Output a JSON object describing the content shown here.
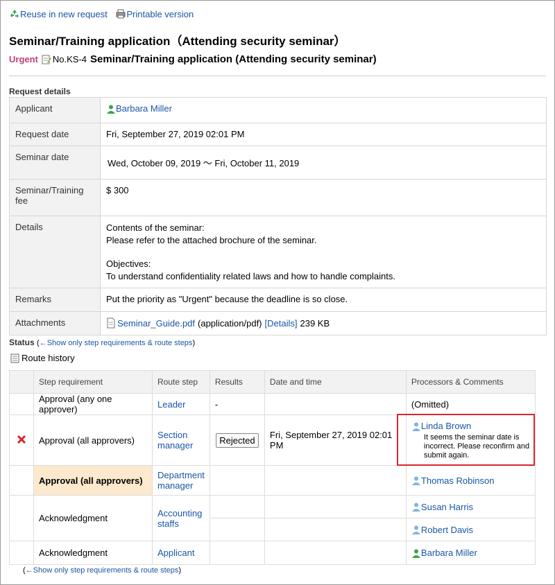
{
  "toolbar": {
    "reuse_label": "Reuse in new request",
    "print_label": "Printable version"
  },
  "page_title": "Seminar/Training application（Attending security seminar）",
  "subtitle": {
    "priority": "Urgent",
    "doc_no": "No.KS-4",
    "title": "Seminar/Training application (Attending security seminar)"
  },
  "details": {
    "section_label": "Request details",
    "applicant_label": "Applicant",
    "applicant": "Barbara Miller",
    "request_date_label": "Request date",
    "request_date": "Fri, September 27, 2019 02:01 PM",
    "seminar_date_label": "Seminar date",
    "seminar_date": "Wed, October 09, 2019 〜 Fri, October 11, 2019",
    "fee_label": "Seminar/Training fee",
    "fee": "$ 300",
    "details_label": "Details",
    "details_line1": "Contents of the seminar:",
    "details_line2": "Please refer to the attached brochure of the seminar.",
    "details_line3": "Objectives:",
    "details_line4": "To understand confidentiality related laws and how to handle complaints.",
    "remarks_label": "Remarks",
    "remarks": "Put the priority as \"Urgent\" because the deadline is so close.",
    "attachments_label": "Attachments",
    "attachment_name": "Seminar_Guide.pdf",
    "attachment_type": "(application/pdf)",
    "attachment_details": "[Details]",
    "attachment_size": "239 KB"
  },
  "status": {
    "label": "Status",
    "toggle_link": "←Show only step requirements & route steps",
    "route_history": "Route history"
  },
  "route": {
    "headers": [
      "Step requirement",
      "Route step",
      "Results",
      "Date and time",
      "Processors & Comments"
    ],
    "rows": [
      {
        "requirement": "Approval (any one approver)",
        "step": "Leader",
        "result": "-",
        "date": "",
        "processor": "(Omitted)"
      },
      {
        "requirement": "Approval (all approvers)",
        "step": "Section manager",
        "result": "Rejected",
        "date": "Fri, September 27, 2019 02:01 PM",
        "processor": "Linda Brown",
        "comment": "It seems the seminar date is incorrect. Please reconfirm and submit again."
      },
      {
        "requirement": "Approval (all approvers)",
        "step": "Department manager",
        "result": "",
        "date": "",
        "processor": "Thomas Robinson"
      },
      {
        "requirement": "Acknowledgment",
        "step": "Accounting staffs",
        "result": "",
        "date": "",
        "processor": "Susan Harris"
      },
      {
        "requirement": "",
        "step": "",
        "result": "",
        "date": "",
        "processor": "Robert Davis"
      },
      {
        "requirement": "Acknowledgment",
        "step": "Applicant",
        "result": "",
        "date": "",
        "processor": "Barbara Miller"
      }
    ]
  },
  "footer_link": "←Show only step requirements & route steps",
  "colors": {
    "link": "#1a56a5",
    "urgent": "#c0407e",
    "highlight": "#fde9cd",
    "callout": "#d9262e"
  }
}
